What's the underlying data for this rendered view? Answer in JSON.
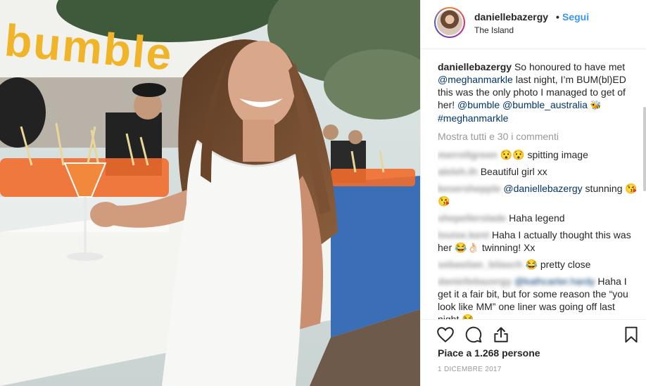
{
  "header": {
    "username": "daniellebazergy",
    "separator": "•",
    "follow_label": "Segui",
    "location": "The Island"
  },
  "photo": {
    "sign_text": "bumble"
  },
  "caption": {
    "username": "daniellebazergy",
    "text_1": "So honoured to have met ",
    "mention_1": "@meghanmarkle",
    "text_2": " last night, I’m BUM(bl)ED this was the only photo I managed to get of her! ",
    "mention_2": "@bumble",
    "text_3": " ",
    "mention_3": "@bumble_australia",
    "emoji": "🐝",
    "text_4": " ",
    "hashtag": "#meghanmarkle"
  },
  "view_all_comments": "Mostra tutti e 30 i commenti",
  "comments": [
    {
      "username": "merrellgreen",
      "text": "😯😯 spitting image"
    },
    {
      "username": "aleleh.th",
      "text": "Beautiful girl xx"
    },
    {
      "username": "kesershepple",
      "mention": "@daniellebazergy",
      "text": " stunning 😘😘"
    },
    {
      "username": "shepellerslade",
      "text": "Haha legend"
    },
    {
      "username": "louise.kent",
      "text": "Haha I actually thought this was her 😂👌🏻 twinning! Xx"
    },
    {
      "username": "sebastian_bilasch",
      "text": "😂 pretty close"
    },
    {
      "username": "daniellebazergy",
      "mention": "@kathcarter.hardy",
      "text": " Haha I get it a fair bit, but for some reason the “you look like MM” one liner was going off last night 😂"
    }
  ],
  "likes_text": "Piace a 1.268 persone",
  "date": "1 DICEMBRE 2017",
  "colors": {
    "link": "#003569",
    "follow": "#3897f0",
    "muted": "#999999"
  },
  "icons": [
    "heart-icon",
    "comment-icon",
    "share-icon",
    "bookmark-icon"
  ]
}
